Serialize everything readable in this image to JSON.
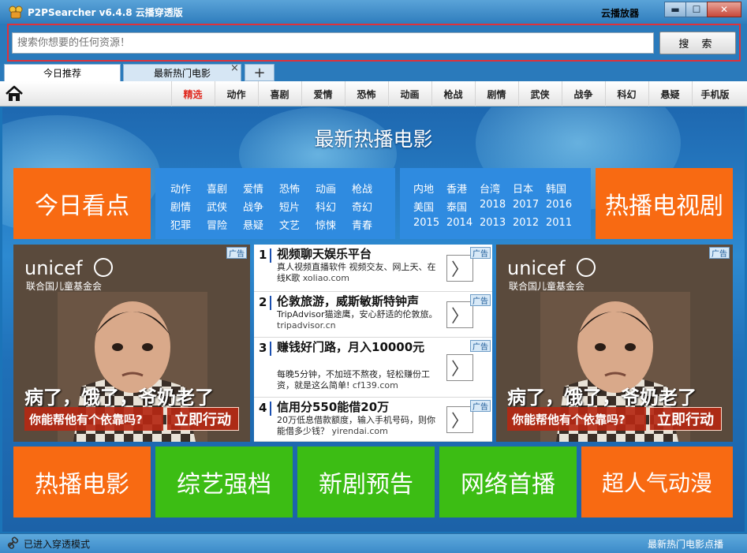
{
  "window": {
    "title": "P2PSearcher v6.4.8 云播穿透版",
    "cloud_player_label": "云播放器",
    "minimize_glyph": "▬",
    "maximize_glyph": "☐",
    "close_glyph": "✕"
  },
  "search": {
    "placeholder": "搜索你想要的任何资源！",
    "button_label": "搜 索"
  },
  "tabs": [
    {
      "label": "今日推荐"
    },
    {
      "label": "最新热门电影"
    }
  ],
  "tab_close_glyph": "×",
  "tab_add_glyph": "+",
  "nav": {
    "items": [
      "精选",
      "动作",
      "喜剧",
      "爱情",
      "恐怖",
      "动画",
      "枪战",
      "剧情",
      "武侠",
      "战争",
      "科幻",
      "悬疑",
      "手机版"
    ],
    "active": "精选"
  },
  "banner": {
    "title": "最新热播电影"
  },
  "tiles": {
    "today": "今日看点",
    "tv": "热播电视剧",
    "hot_movies": "热播电影",
    "variety": "综艺强档",
    "new_drama": "新剧预告",
    "web_first": "网络首播",
    "anime": "超人气动漫"
  },
  "genres": [
    [
      "动作",
      "喜剧",
      "爱情",
      "恐怖",
      "动画",
      "枪战"
    ],
    [
      "剧情",
      "武侠",
      "战争",
      "短片",
      "科幻",
      "奇幻"
    ],
    [
      "犯罪",
      "冒险",
      "悬疑",
      "文艺",
      "惊悚",
      "青春"
    ]
  ],
  "regions": [
    [
      "内地",
      "香港",
      "台湾",
      "日本",
      "韩国"
    ],
    [
      "美国",
      "泰国",
      "2018",
      "2017",
      "2016"
    ],
    [
      "2015",
      "2014",
      "2013",
      "2012",
      "2011"
    ]
  ],
  "image_ads": {
    "tag": "广告",
    "logo_text": "unicef",
    "org_name": "联合国儿童基金会",
    "headline": "病了，饿了，爷奶老了",
    "question": "你能帮他有个依靠吗?",
    "action": "立即行动"
  },
  "text_ads": [
    {
      "num": "1",
      "title": "视频聊天娱乐平台",
      "desc": "真人视频直播软件 视频交友、网上天、在线K歌",
      "url": "xoliao.com",
      "tag": "广告",
      "arrow": "〉"
    },
    {
      "num": "2",
      "title": "伦敦旅游，威斯敏斯特钟声",
      "desc": "TripAdvisor猫途鹰，安心舒适的伦敦旅。",
      "url": "tripadvisor.cn",
      "tag": "广告",
      "arrow": "〉"
    },
    {
      "num": "3",
      "title": "赚钱好门路，月入10000元",
      "desc": "每晚5分钟，不加班不熬夜，轻松赚份工资，就是这么简单!",
      "url": "cf139.com",
      "tag": "广告",
      "arrow": "〉"
    },
    {
      "num": "4",
      "title": "信用分550能借20万",
      "desc": "20万低息借款额度，输入手机号码，则你能借多少钱？",
      "url": "yirendai.com",
      "tag": "广告",
      "arrow": "〉"
    }
  ],
  "status": {
    "left": "已进入穿透模式",
    "right": "最新热门电影点播"
  },
  "colors": {
    "orange_tile": "#f86a12",
    "green_tile": "#3cbd14",
    "blue_box": "#2f8be0",
    "highlight_frame": "#e0323a",
    "active_nav": "#e0271d"
  },
  "icons": [
    "app-icon",
    "home-icon",
    "globe-icon",
    "arrow-right-icon",
    "status-link-icon"
  ]
}
